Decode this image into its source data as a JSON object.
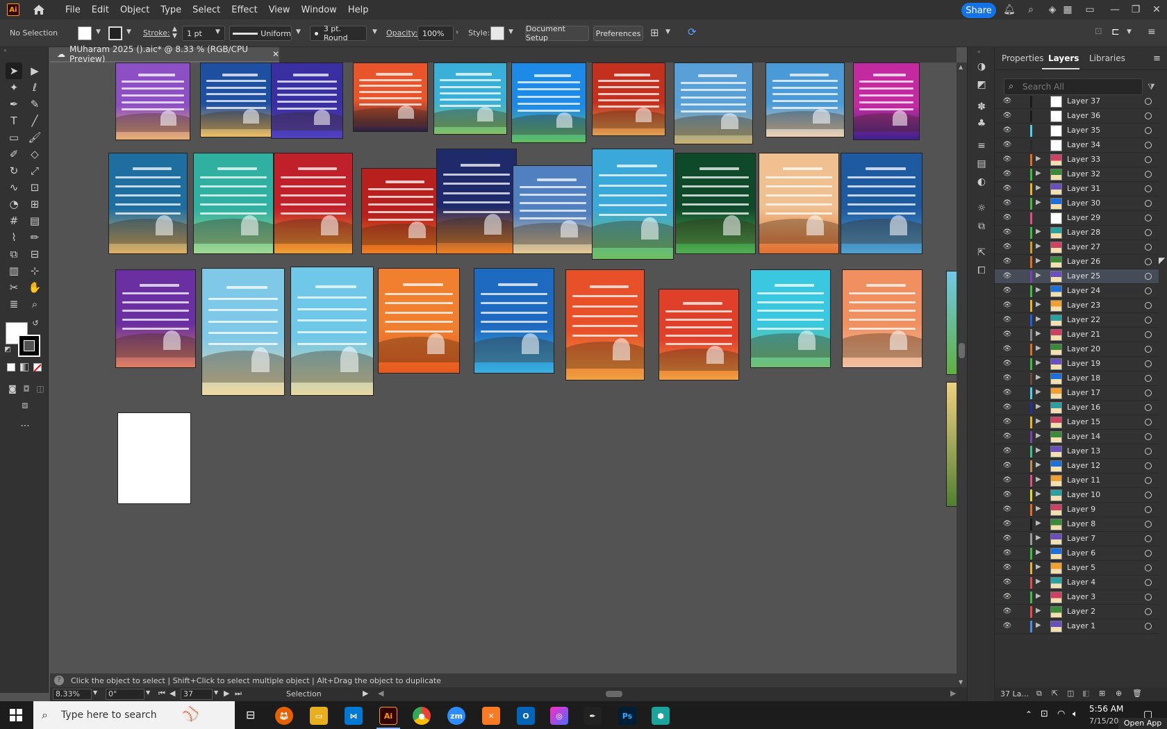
{
  "app": {
    "logo": "Ai",
    "menus": [
      "File",
      "Edit",
      "Object",
      "Type",
      "Select",
      "Effect",
      "View",
      "Window",
      "Help"
    ],
    "share": "Share"
  },
  "control": {
    "selection": "No Selection",
    "stroke_label": "Stroke:",
    "stroke_value": "1 pt",
    "uniform": "Uniform",
    "brush": "3 pt. Round",
    "opacity_label": "Opacity:",
    "opacity_value": "100%",
    "style_label": "Style:",
    "doc_setup": "Document Setup",
    "preferences": "Preferences"
  },
  "document": {
    "tab": "MUharam 2025 ().aic* @ 8.33 % (RGB/CPU Preview)"
  },
  "status": {
    "hint": "Click the object to select  |  Shift+Click to select multiple object  |  Alt+Drag the object to duplicate",
    "zoom": "8.33%",
    "rotation": "0°",
    "artboard": "37",
    "mode": "Selection"
  },
  "panel": {
    "tabs": [
      "Properties",
      "Layers",
      "Libraries"
    ],
    "active_tab": "Layers",
    "search_placeholder": "Search All",
    "footer": "37 La...",
    "layers": [
      {
        "name": "Layer 37",
        "color": "#1a1a1a"
      },
      {
        "name": "Layer 36",
        "color": "#1a1a1a"
      },
      {
        "name": "Layer 35",
        "color": "#4fd1e8"
      },
      {
        "name": "Layer 34",
        "color": "#2a2a2a"
      },
      {
        "name": "Layer 33",
        "color": "#e86d1e"
      },
      {
        "name": "Layer 32",
        "color": "#3fbf3f"
      },
      {
        "name": "Layer 31",
        "color": "#e8b61e"
      },
      {
        "name": "Layer 30",
        "color": "#3fbf3f"
      },
      {
        "name": "Layer 29",
        "color": "#e84a8a"
      },
      {
        "name": "Layer 28",
        "color": "#3fbf3f"
      },
      {
        "name": "Layer 27",
        "color": "#d4a017"
      },
      {
        "name": "Layer 26",
        "color": "#e86d1e"
      },
      {
        "name": "Layer 25",
        "color": "#7a3fbf"
      },
      {
        "name": "Layer 24",
        "color": "#3fbf3f"
      },
      {
        "name": "Layer 23",
        "color": "#e8b61e"
      },
      {
        "name": "Layer 22",
        "color": "#1e5fe8"
      },
      {
        "name": "Layer 21",
        "color": "#8a8a8a"
      },
      {
        "name": "Layer 20",
        "color": "#e86d1e"
      },
      {
        "name": "Layer 19",
        "color": "#3fbf3f"
      },
      {
        "name": "Layer 18",
        "color": "#6b4b3a"
      },
      {
        "name": "Layer 17",
        "color": "#4fd1e8"
      },
      {
        "name": "Layer 16",
        "color": "#1e2fb0"
      },
      {
        "name": "Layer 15",
        "color": "#e8b61e"
      },
      {
        "name": "Layer 14",
        "color": "#7a3fbf"
      },
      {
        "name": "Layer 13",
        "color": "#3fbf8a"
      },
      {
        "name": "Layer 12",
        "color": "#c48a4a"
      },
      {
        "name": "Layer 11",
        "color": "#e84a8a"
      },
      {
        "name": "Layer 10",
        "color": "#e8d81e"
      },
      {
        "name": "Layer 9",
        "color": "#e86d1e"
      },
      {
        "name": "Layer 8",
        "color": "#1a1a1a"
      },
      {
        "name": "Layer 7",
        "color": "#9a9a9a"
      },
      {
        "name": "Layer 6",
        "color": "#3fbf3f"
      },
      {
        "name": "Layer 5",
        "color": "#e8b61e"
      },
      {
        "name": "Layer 4",
        "color": "#e84a4a"
      },
      {
        "name": "Layer 3",
        "color": "#3fbf3f"
      },
      {
        "name": "Layer 2",
        "color": "#e84a4a"
      },
      {
        "name": "Layer 1",
        "color": "#4f8ae8"
      }
    ],
    "selected_layer": "Layer 25"
  },
  "taskbar": {
    "search_placeholder": "Type here to search",
    "time": "5:56 AM",
    "date": "7/15/2025",
    "open_app": "Open App"
  }
}
